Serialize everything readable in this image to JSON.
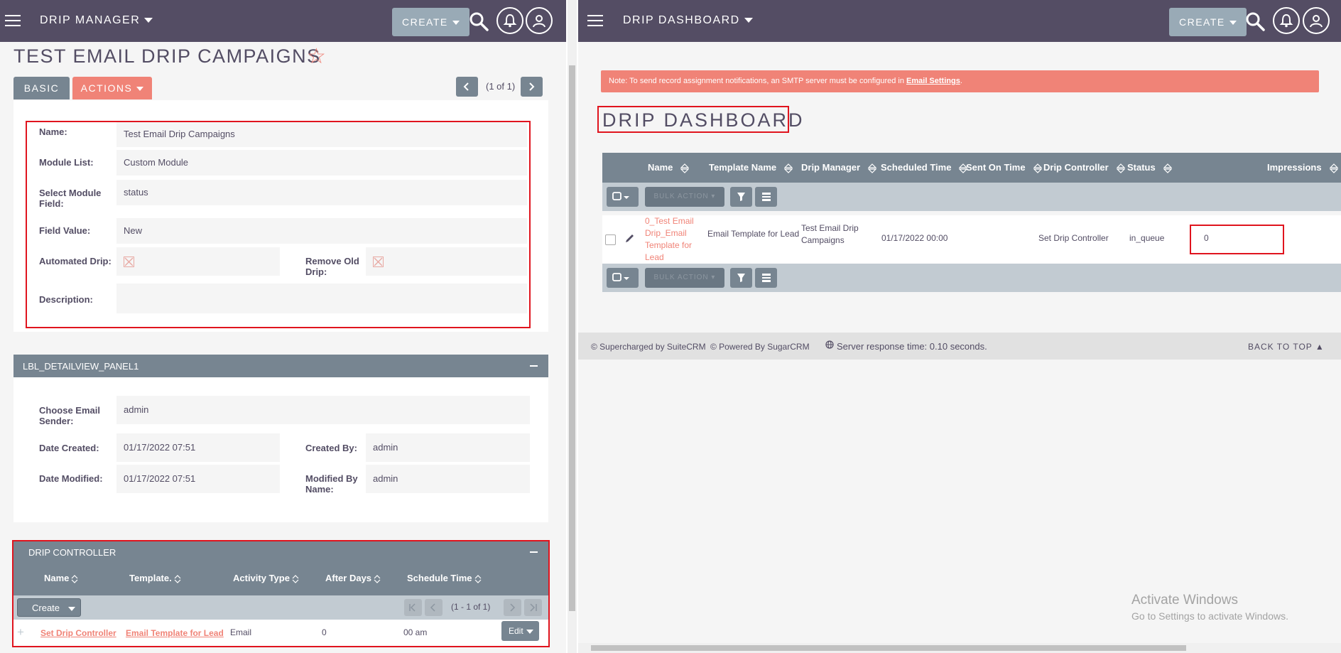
{
  "left": {
    "app_title": "DRIP MANAGER",
    "create_label": "CREATE",
    "record_title": "TEST EMAIL DRIP CAMPAIGNS",
    "tabs": {
      "basic": "BASIC",
      "actions": "ACTIONS"
    },
    "pager": "(1 of 1)",
    "fields": {
      "name_label": "Name:",
      "name_value": "Test Email Drip Campaigns",
      "module_list_label": "Module List:",
      "module_list_value": "Custom Module",
      "select_field_label": "Select Module Field:",
      "select_field_value": "status",
      "field_value_label": "Field Value:",
      "field_value_value": "New",
      "automated_drip_label": "Automated Drip:",
      "remove_old_drip_label": "Remove Old Drip:",
      "description_label": "Description:"
    },
    "panel1": {
      "title": "LBL_DETAILVIEW_PANEL1",
      "email_sender_label": "Choose Email Sender:",
      "email_sender_value": "admin",
      "date_created_label": "Date Created:",
      "date_created_value": "01/17/2022 07:51",
      "created_by_label": "Created By:",
      "created_by_value": "admin",
      "date_modified_label": "Date Modified:",
      "date_modified_value": "01/17/2022 07:51",
      "modified_by_label": "Modified By Name:",
      "modified_by_value": "admin"
    },
    "drip_controller": {
      "title": "DRIP CONTROLLER",
      "columns": [
        "Name",
        "Template.",
        "Activity Type",
        "After Days",
        "Schedule Time"
      ],
      "create_label": "Create",
      "pager": "(1 - 1 of 1)",
      "row": {
        "name": "Set Drip Controller",
        "template": "Email Template for Lead",
        "activity_type": "Email",
        "after_days": "0",
        "schedule_time": "00 am"
      },
      "edit_label": "Edit"
    }
  },
  "right": {
    "app_title": "DRIP DASHBOARD",
    "create_label": "CREATE",
    "notice_prefix": "Note: To send record assignment notifications, an SMTP server must be configured in ",
    "notice_link": "Email Settings",
    "notice_suffix": ".",
    "dashboard_title": "DRIP DASHBOARD",
    "columns": [
      "Name",
      "Template Name",
      "Drip Manager",
      "Scheduled Time",
      "Sent On Time",
      "Drip Controller",
      "Status",
      "Impressions"
    ],
    "bulk_action": "BULK ACTION",
    "row": {
      "name": "0_Test Email Drip_Email Template for Lead",
      "template_name": "Email Template for Lead",
      "drip_manager": "Test Email Drip Campaigns",
      "scheduled_time": "01/17/2022 00:00",
      "sent_on_time": "",
      "drip_controller": "Set Drip Controller",
      "status": "in_queue",
      "impressions": "0"
    },
    "footer": {
      "supercharged": "© Supercharged by SuiteCRM",
      "powered": "© Powered By SugarCRM",
      "response": "Server response time: 0.10 seconds.",
      "back_to_top": "BACK TO TOP"
    },
    "watermark": {
      "line1": "Activate Windows",
      "line2": "Go to Settings to activate Windows."
    }
  },
  "colors": {
    "header": "#544d64",
    "accent": "#f08377",
    "panel": "#778591",
    "highlight_border": "#e0141e"
  }
}
